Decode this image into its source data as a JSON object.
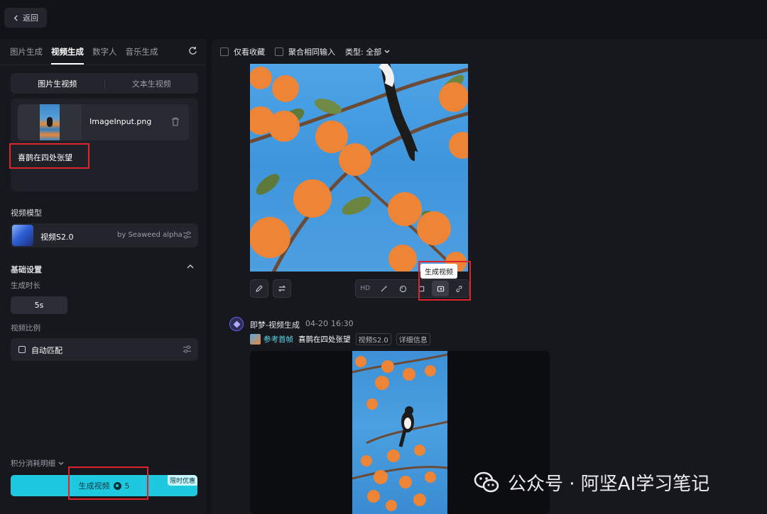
{
  "top": {
    "back_label": "返回"
  },
  "left": {
    "tabs": [
      "图片生成",
      "视频生成",
      "数字人",
      "音乐生成"
    ],
    "active_tab_index": 1,
    "mode_options": [
      "图片生视频",
      "文本生视频"
    ],
    "active_mode_index": 0,
    "upload": {
      "file_name": "ImageInput.png",
      "prompt": "喜鹊在四处张望"
    },
    "model_section_label": "视频模型",
    "model": {
      "name": "视频S2.0",
      "by": "by Seaweed alpha"
    },
    "basic_settings_label": "基础设置",
    "duration_label": "生成时长",
    "duration_value": "5s",
    "ratio_label": "视频比例",
    "ratio_value": "自动匹配",
    "cost_label": "积分消耗明细",
    "generate_label": "生成视频",
    "generate_cost": "5",
    "promo_badge": "限时优惠"
  },
  "right": {
    "filters": {
      "favorites_only": "仅看收藏",
      "aggregate_same_input": "聚合相同输入",
      "type_label": "类型: 全部"
    },
    "toolbar": {
      "hd_label": "HD"
    },
    "tooltip": "生成视频",
    "record": {
      "author": "即梦-视频生成",
      "date": "04-20",
      "time": "16:30",
      "ref_label": "参考首帧",
      "prompt": "喜鹊在四处张望",
      "model_chip": "视频S2.0",
      "detail_chip": "详细信息"
    }
  },
  "watermark": {
    "text": "公众号 · 阿坚AI学习笔记"
  },
  "colors": {
    "accent": "#1ec9e0",
    "highlight_red": "#e0242b",
    "background": "#121318"
  }
}
